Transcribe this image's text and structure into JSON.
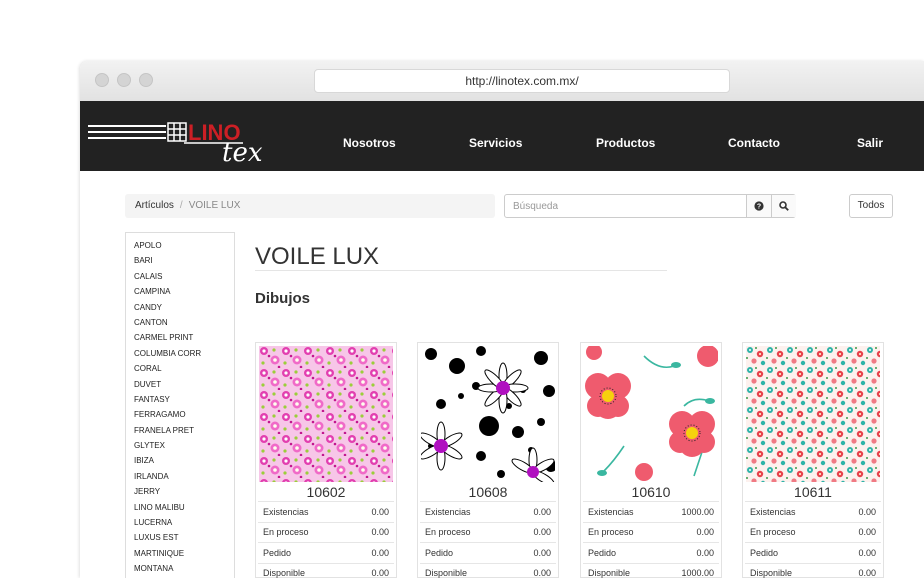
{
  "browser": {
    "url": "http://linotex.com.mx/"
  },
  "navbar": {
    "logo_text": "LINO",
    "logo_script": "tex",
    "links": [
      "Nosotros",
      "Servicios",
      "Productos",
      "Contacto",
      "Salir"
    ]
  },
  "breadcrumb": {
    "root": "Artículos",
    "current": "VOILE LUX"
  },
  "search": {
    "placeholder": "Búsqueda",
    "help_icon": "question-circle-icon",
    "search_icon": "magnifier-icon"
  },
  "todos_label": "Todos",
  "sidebar": {
    "items": [
      "APOLO",
      "BARI",
      "CALAIS",
      "CAMPINA",
      "CANDY",
      "CANTON",
      "CARMEL PRINT",
      "COLUMBIA CORR",
      "CORAL",
      "DUVET",
      "FANTASY",
      "FERRAGAMO",
      "FRANELA PRET",
      "GLYTEX",
      "IBIZA",
      "IRLANDA",
      "JERRY",
      "LINO MALIBU",
      "LUCERNA",
      "LUXUS EST",
      "MARTINIQUE",
      "MONTANA"
    ]
  },
  "main": {
    "title": "VOILE LUX",
    "subtitle": "Dibujos",
    "products": [
      {
        "code": "10602",
        "pattern": "pink-mini-floral",
        "rows": [
          {
            "label": "Existencias",
            "value": "0.00"
          },
          {
            "label": "En proceso",
            "value": "0.00"
          },
          {
            "label": "Pedido",
            "value": "0.00"
          },
          {
            "label": "Disponible",
            "value": "0.00"
          }
        ]
      },
      {
        "code": "10608",
        "pattern": "black-dots-daisies",
        "rows": [
          {
            "label": "Existencias",
            "value": "0.00"
          },
          {
            "label": "En proceso",
            "value": "0.00"
          },
          {
            "label": "Pedido",
            "value": "0.00"
          },
          {
            "label": "Disponible",
            "value": "0.00"
          }
        ]
      },
      {
        "code": "10610",
        "pattern": "coral-poppies",
        "rows": [
          {
            "label": "Existencias",
            "value": "1000.00"
          },
          {
            "label": "En proceso",
            "value": "0.00"
          },
          {
            "label": "Pedido",
            "value": "0.00"
          },
          {
            "label": "Disponible",
            "value": "1000.00"
          }
        ]
      },
      {
        "code": "10611",
        "pattern": "teal-red-ditsy-floral",
        "rows": [
          {
            "label": "Existencias",
            "value": "0.00"
          },
          {
            "label": "En proceso",
            "value": "0.00"
          },
          {
            "label": "Pedido",
            "value": "0.00"
          },
          {
            "label": "Disponible",
            "value": "0.00"
          }
        ]
      }
    ]
  },
  "colors": {
    "navbar_bg": "#222222",
    "logo_red": "#cc1f25",
    "accent_magenta": "#b010c0"
  }
}
